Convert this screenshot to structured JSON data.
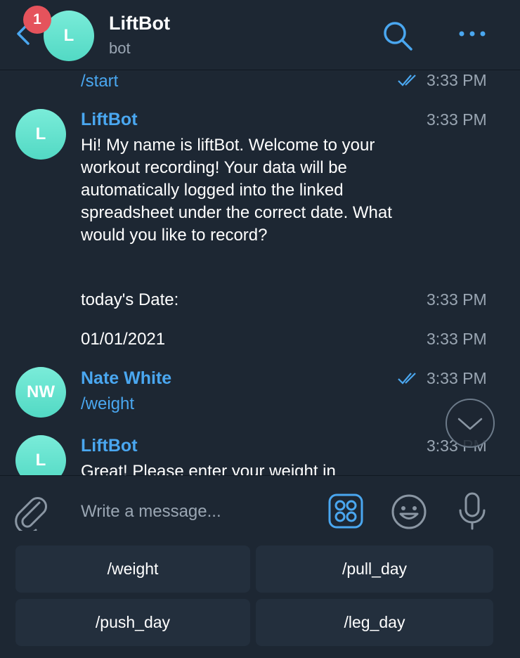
{
  "header": {
    "unread_count": "1",
    "avatar_letter": "L",
    "title": "LiftBot",
    "subtitle": "bot"
  },
  "messages": [
    {
      "text": "/start",
      "time": "3:33 PM"
    },
    {
      "sender": "LiftBot",
      "avatar": "L",
      "time": "3:33 PM",
      "text": "Hi! My name is liftBot. Welcome to your workout recording! Your data will be automatically logged into the linked spreadsheet under the correct date. What would you like to record?"
    },
    {
      "text": "today's Date:",
      "time": "3:33 PM"
    },
    {
      "text": "01/01/2021",
      "time": "3:33 PM"
    },
    {
      "sender": "Nate White",
      "avatar": "NW",
      "time": "3:33 PM",
      "text": "/weight"
    },
    {
      "sender": "LiftBot",
      "avatar": "L",
      "time": "3:33 PM",
      "text": "Great! Please enter your weight in"
    }
  ],
  "composer": {
    "placeholder": "Write a message..."
  },
  "keyboard": {
    "buttons": [
      "/weight",
      "/pull_day",
      "/push_day",
      "/leg_day"
    ]
  },
  "colors": {
    "background": "#1d2733",
    "accent": "#4aa7f0",
    "badge": "#e5535c",
    "avatar": "#5ddfc9",
    "muted": "#9aa6b3"
  }
}
